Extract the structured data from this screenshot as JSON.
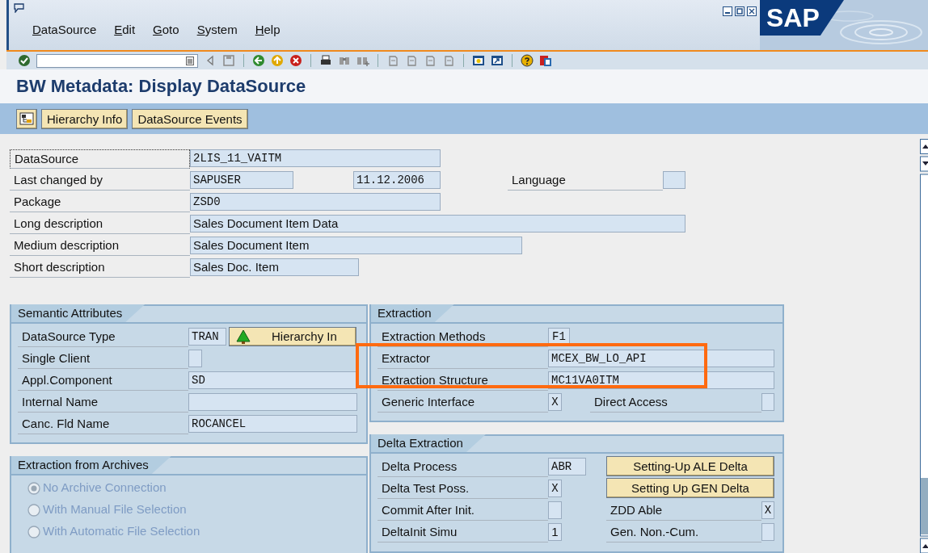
{
  "window": {
    "logo": "SAP",
    "title": "BW Metadata: Display DataSource"
  },
  "menu": [
    {
      "label": "DataSource"
    },
    {
      "label": "Edit"
    },
    {
      "label": "Goto"
    },
    {
      "label": "System"
    },
    {
      "label": "Help"
    }
  ],
  "app_toolbar": [
    {
      "kind": "icon"
    },
    {
      "kind": "button",
      "label": "Hierarchy Info"
    },
    {
      "kind": "button",
      "label": "DataSource Events"
    }
  ],
  "header": [
    {
      "label": "DataSource",
      "focused": true,
      "fields": [
        {
          "kind": "code",
          "value": "2LIS_11_VAITM"
        }
      ]
    },
    {
      "label": "Last changed by",
      "focused": false,
      "fields": [
        {
          "kind": "code",
          "value": "SAPUSER"
        },
        {
          "kind": "code",
          "value": "11.12.2006"
        }
      ],
      "side": {
        "kind": "field",
        "label": "Language",
        "fields": [
          {
            "kind": "empty"
          }
        ]
      }
    },
    {
      "label": "Package",
      "focused": false,
      "fields": [
        {
          "kind": "code",
          "value": "ZSD0"
        }
      ]
    },
    {
      "label": "Long description",
      "focused": false,
      "fields": [
        {
          "kind": "text",
          "value": "Sales Document Item Data"
        }
      ]
    },
    {
      "label": "Medium description",
      "focused": false,
      "fields": [
        {
          "kind": "text",
          "value": "Sales Document Item"
        }
      ]
    },
    {
      "label": "Short description",
      "focused": false,
      "fields": [
        {
          "kind": "text",
          "value": "Sales Doc. Item"
        }
      ]
    }
  ],
  "semantic_attributes": {
    "title": "Semantic Attributes",
    "rows": [
      {
        "label": "DataSource Type",
        "fields": [
          {
            "kind": "code",
            "value": "TRAN"
          },
          {
            "kind": "button",
            "label": "Hierarchy In"
          }
        ]
      },
      {
        "label": "Single Client",
        "fields": [
          {
            "kind": "empty"
          }
        ]
      },
      {
        "label": "Appl.Component",
        "fields": [
          {
            "kind": "code",
            "value": "SD"
          }
        ]
      },
      {
        "label": "Internal Name",
        "fields": [
          {
            "kind": "empty"
          }
        ]
      },
      {
        "label": "Canc. Fld Name",
        "fields": [
          {
            "kind": "code",
            "value": "ROCANCEL"
          }
        ]
      }
    ]
  },
  "extraction": {
    "title": "Extraction",
    "rows": [
      {
        "label": "Extraction Methods",
        "fields": [
          {
            "kind": "code",
            "value": "F1"
          }
        ]
      },
      {
        "label": "Extractor",
        "fields": [
          {
            "kind": "code",
            "value": "MCEX_BW_LO_API"
          }
        ]
      },
      {
        "label": "Extraction Structure",
        "fields": [
          {
            "kind": "code",
            "value": "MC11VA0ITM"
          }
        ]
      },
      {
        "label": "Generic Interface",
        "fields": [
          {
            "kind": "code",
            "value": "X"
          }
        ],
        "side": {
          "kind": "field",
          "label": "Direct Access",
          "fields": [
            {
              "kind": "empty"
            }
          ]
        }
      }
    ]
  },
  "archive_extraction": {
    "title": "Extraction from Archives",
    "options": [
      {
        "label": "No Archive Connection",
        "selected": true,
        "disabled": true
      },
      {
        "label": "With Manual File Selection",
        "selected": false,
        "disabled": true
      },
      {
        "label": "With Automatic File Selection",
        "selected": false,
        "disabled": true
      }
    ]
  },
  "delta_extraction": {
    "title": "Delta Extraction",
    "rows": [
      {
        "label": "Delta Process",
        "fields": [
          {
            "kind": "code",
            "value": "ABR"
          }
        ],
        "side": {
          "kind": "button",
          "label": "Setting-Up ALE Delta"
        }
      },
      {
        "label": "Delta Test Poss.",
        "fields": [
          {
            "kind": "code",
            "value": "X"
          }
        ],
        "side": {
          "kind": "button",
          "label": "Setting Up GEN Delta"
        }
      },
      {
        "label": "Commit After Init.",
        "fields": [
          {
            "kind": "empty"
          }
        ],
        "side": {
          "kind": "field",
          "label": "ZDD Able",
          "fields": [
            {
              "kind": "code",
              "value": "X"
            }
          ]
        }
      },
      {
        "label": "DeltaInit Simu",
        "fields": [
          {
            "kind": "text",
            "value": "1"
          }
        ],
        "side": {
          "kind": "field",
          "label": "Gen. Non.-Cum.",
          "fields": [
            {
              "kind": "empty"
            }
          ]
        }
      }
    ]
  }
}
